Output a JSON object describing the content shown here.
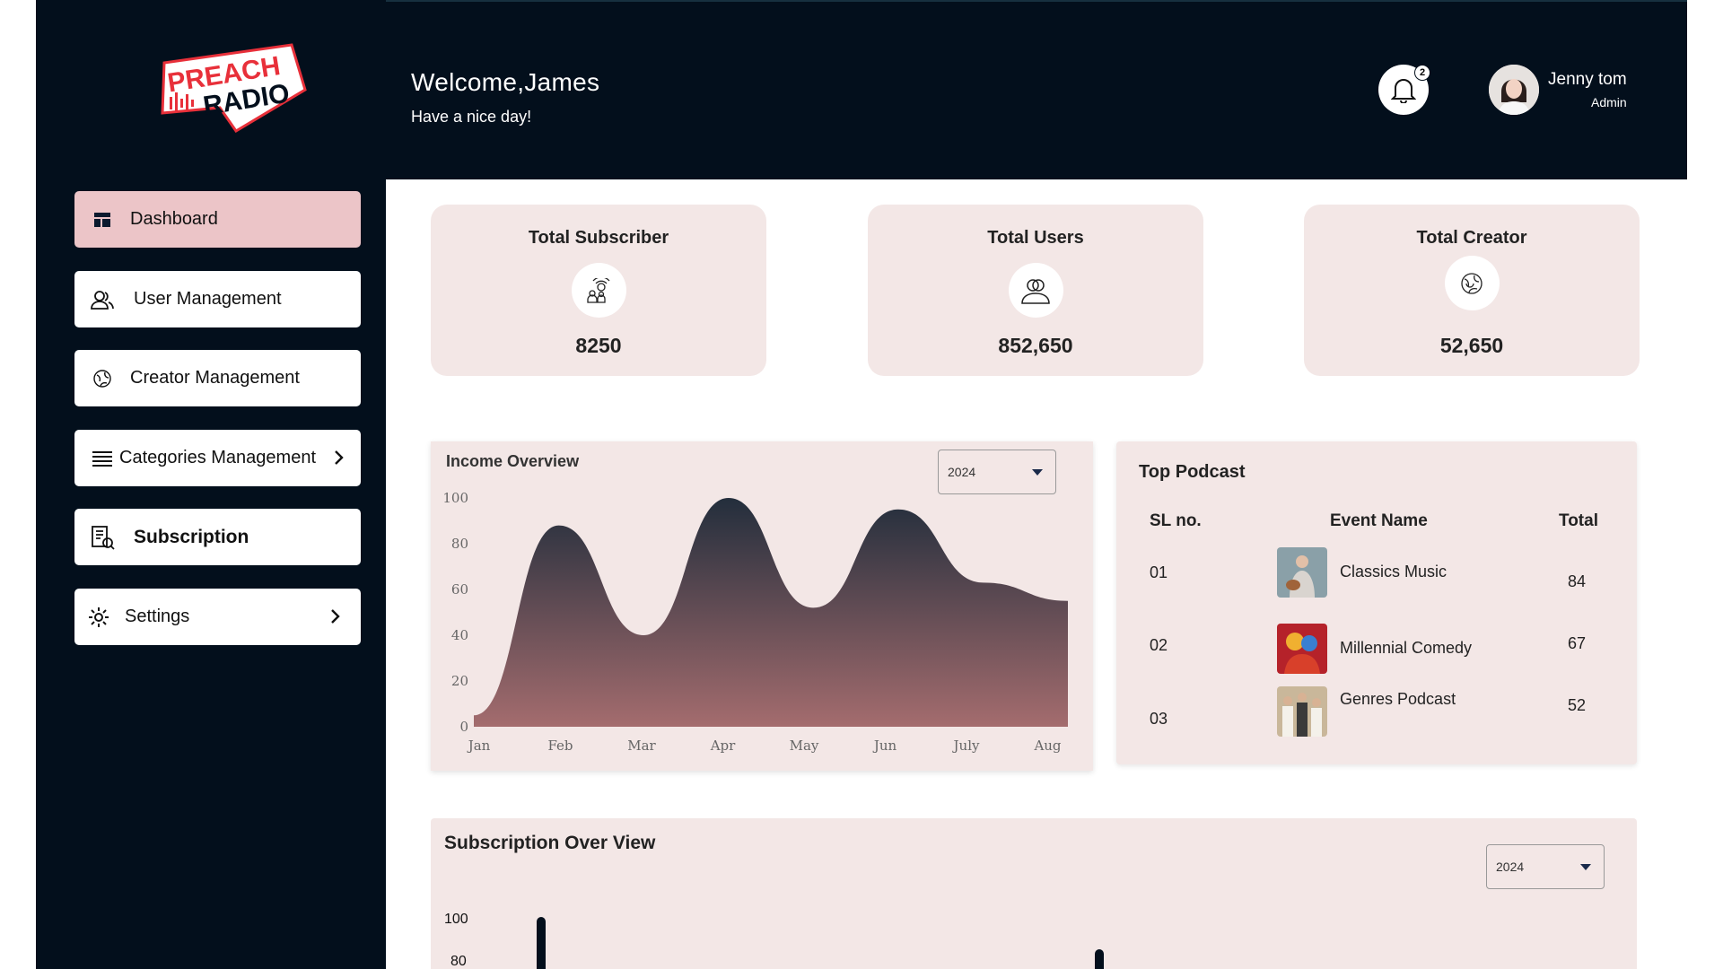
{
  "brand": {
    "logo_line1": "PREACH",
    "logo_line2": "RADIO",
    "accent": "#e8303a"
  },
  "sidebar": {
    "items": [
      {
        "label": "Dashboard",
        "icon": "dashboard-icon",
        "active": true
      },
      {
        "label": "User Management",
        "icon": "users-icon"
      },
      {
        "label": "Creator Management",
        "icon": "creator-icon"
      },
      {
        "label": "Categories Management",
        "icon": "list-icon"
      },
      {
        "label": "Subscription",
        "icon": "subscription-icon"
      },
      {
        "label": "Settings",
        "icon": "gear-icon"
      }
    ]
  },
  "header": {
    "welcome": "Welcome,James",
    "subtitle": "Have a nice day!",
    "notifications": "2",
    "user_name": "Jenny tom",
    "user_role": "Admin"
  },
  "stats": [
    {
      "title": "Total Subscriber",
      "value": "8250",
      "icon": "subscriber-icon"
    },
    {
      "title": "Total Users",
      "value": "852,650",
      "icon": "users-icon"
    },
    {
      "title": "Total Creator",
      "value": "52,650",
      "icon": "creator-icon"
    }
  ],
  "income": {
    "title": "Income Overview",
    "year": "2024"
  },
  "chart_data": {
    "type": "area",
    "categories": [
      "Jan",
      "Feb",
      "Mar",
      "Apr",
      "May",
      "Jun",
      "July",
      "Aug"
    ],
    "values": [
      5,
      88,
      40,
      100,
      52,
      95,
      63,
      55
    ],
    "ylim": [
      0,
      100
    ],
    "yticks": [
      "100",
      "80",
      "60",
      "40",
      "20",
      "0"
    ],
    "title": "Income Overview"
  },
  "top_podcast": {
    "title": "Top Podcast",
    "headers": [
      "SL no.",
      "Event Name",
      "Total"
    ],
    "rows": [
      {
        "sl": "01",
        "name": "Classics Music",
        "total": "84"
      },
      {
        "sl": "02",
        "name": "Millennial Comedy",
        "total": "67"
      },
      {
        "sl": "03",
        "name": "Genres Podcast",
        "total": "52"
      }
    ]
  },
  "subscription": {
    "title": "Subscription Over View",
    "year": "2024",
    "yticks": [
      "100",
      "80"
    ]
  }
}
